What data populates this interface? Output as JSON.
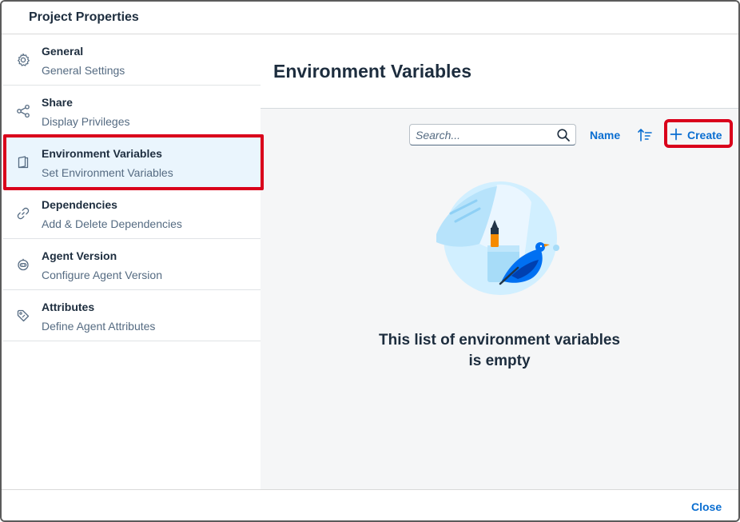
{
  "dialog": {
    "title": "Project Properties"
  },
  "sidebar": {
    "items": [
      {
        "title": "General",
        "subtitle": "General Settings",
        "icon": "gear-icon"
      },
      {
        "title": "Share",
        "subtitle": "Display Privileges",
        "icon": "share-icon"
      },
      {
        "title": "Environment Variables",
        "subtitle": "Set Environment Variables",
        "icon": "document-icon",
        "selected": true
      },
      {
        "title": "Dependencies",
        "subtitle": "Add & Delete Dependencies",
        "icon": "link-icon"
      },
      {
        "title": "Agent Version",
        "subtitle": "Configure Agent Version",
        "icon": "robot-icon"
      },
      {
        "title": "Attributes",
        "subtitle": "Define Agent Attributes",
        "icon": "tag-icon"
      }
    ]
  },
  "content": {
    "title": "Environment Variables",
    "toolbar": {
      "search_placeholder": "Search...",
      "sort_label": "Name",
      "create_label": "Create"
    },
    "empty_state": {
      "line1": "This list of environment variables",
      "line2": "is empty"
    }
  },
  "footer": {
    "close_label": "Close"
  },
  "colors": {
    "accent": "#0a6ed1",
    "highlight": "#d9001b",
    "selected_bg": "#eaf5fd"
  }
}
